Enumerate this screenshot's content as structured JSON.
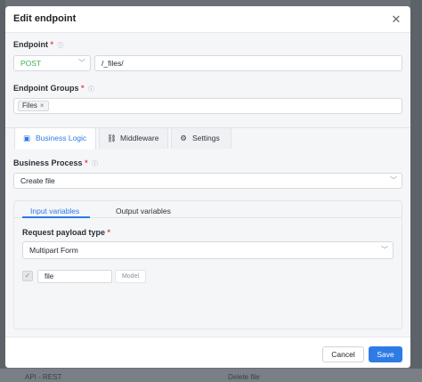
{
  "modal": {
    "title": "Edit endpoint",
    "close_icon": "close-icon"
  },
  "endpoint": {
    "label": "Endpoint",
    "required": "*",
    "method": "POST",
    "path": "/_files/"
  },
  "groups": {
    "label": "Endpoint Groups",
    "required": "*",
    "tags": [
      "Files"
    ]
  },
  "tabs": [
    {
      "label": "Business Logic",
      "icon": "play-square-icon",
      "active": true
    },
    {
      "label": "Middleware",
      "icon": "link-icon",
      "active": false
    },
    {
      "label": "Settings",
      "icon": "gear-icon",
      "active": false
    }
  ],
  "business_process": {
    "label": "Business Process",
    "required": "*",
    "value": "Create file"
  },
  "subtabs": [
    {
      "label": "Input variables",
      "active": true
    },
    {
      "label": "Output variables",
      "active": false
    }
  ],
  "payload": {
    "label": "Request payload type",
    "required": "*",
    "value": "Multipart Form"
  },
  "variable": {
    "name": "file",
    "model_label": "Model",
    "checked": true
  },
  "footer": {
    "cancel_label": "Cancel",
    "save_label": "Save"
  },
  "background": {
    "left_text": "API - REST",
    "right_text": "Delete file"
  },
  "colors": {
    "accent": "#2f7be5",
    "method": "#3fae52",
    "required": "#e5484d"
  }
}
